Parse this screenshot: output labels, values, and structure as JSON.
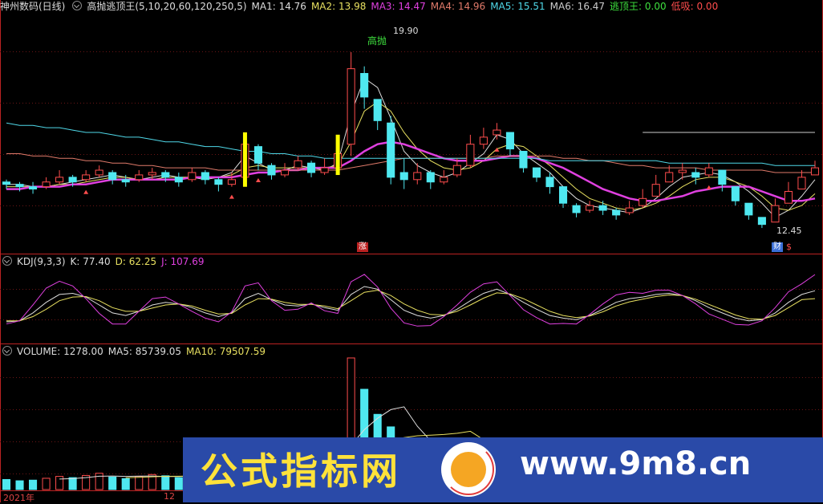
{
  "main_header": {
    "stock": "神州数码(日线)",
    "indicator": "高抛逃顶王(5,10,20,60,120,250,5)",
    "ma1_label": "MA1: 14.76",
    "ma2_label": "MA2: 13.98",
    "ma3_label": "MA3: 14.47",
    "ma4_label": "MA4: 14.96",
    "ma5_label": "MA5: 15.51",
    "ma6_label": "MA6: 16.47",
    "escape_label": "逃顶王: 0.00",
    "low_label": "低吸: 0.00"
  },
  "kdj_header": {
    "name": "KDJ(9,3,3)",
    "k_label": "K: 77.40",
    "d_label": "D: 62.25",
    "j_label": "J: 107.69"
  },
  "vol_header": {
    "name": "VOLUME: 1278.00",
    "ma5_label": "MA5: 85739.05",
    "ma10_label": "MA10: 79507.59"
  },
  "annotations": {
    "high_price": "19.90",
    "low_price": "12.45",
    "high_sell": "高抛",
    "rise_mark": "涨",
    "fin_mark": "财",
    "s_mark": "$"
  },
  "x_labels": {
    "year": "2021年",
    "month": "12"
  },
  "banner": {
    "title": "公式指标网",
    "url": "www.9m8.cn"
  },
  "colors": {
    "up": "#ff4d4d",
    "down": "#4fe8f0",
    "ma_purple": "#e040e0",
    "ma_white": "#dddddd",
    "ma_yellow": "#e8e060",
    "ma_cyan": "#4fd8e8",
    "ma_salmon": "#e07a6a",
    "signal_yellow": "#ffff00"
  },
  "chart_data": [
    {
      "type": "candlestick",
      "title": "神州数码(日线)",
      "ylim": [
        11.5,
        21.5
      ],
      "series": [
        {
          "name": "MA1",
          "values": [
            14.3,
            14.3,
            14.2,
            14.2,
            14.3,
            14.4,
            14.5,
            14.6,
            14.7,
            14.6,
            14.5,
            14.6,
            14.7,
            14.6,
            14.6,
            14.5,
            14.6,
            14.8,
            15.5,
            15.2,
            14.9,
            14.9,
            15.1,
            15.0,
            14.9,
            15.2,
            17.3,
            18.8,
            18.4,
            17.1,
            15.7,
            15.1,
            14.8,
            14.6,
            14.8,
            15.2,
            15.6,
            16.4,
            16.2,
            15.6,
            15.2,
            14.8,
            14.2,
            13.7,
            13.4,
            13.3,
            13.2,
            13.1,
            13.3,
            13.7,
            14.2,
            14.6,
            14.7,
            14.8,
            14.7,
            14.4,
            14.0,
            13.5,
            12.9,
            13.2,
            13.8,
            14.5
          ]
        },
        {
          "name": "MA2",
          "values": [
            14.2,
            14.2,
            14.2,
            14.2,
            14.3,
            14.3,
            14.4,
            14.5,
            14.6,
            14.6,
            14.5,
            14.5,
            14.6,
            14.6,
            14.6,
            14.6,
            14.6,
            14.7,
            15.0,
            15.1,
            15.0,
            15.0,
            15.0,
            15.0,
            15.0,
            15.1,
            16.1,
            17.4,
            17.8,
            17.4,
            16.5,
            15.8,
            15.3,
            15.0,
            14.9,
            15.0,
            15.3,
            15.8,
            16.0,
            15.9,
            15.5,
            15.1,
            14.6,
            14.1,
            13.7,
            13.5,
            13.3,
            13.2,
            13.3,
            13.5,
            13.8,
            14.2,
            14.5,
            14.6,
            14.6,
            14.4,
            14.2,
            13.8,
            13.3,
            13.2,
            13.4,
            13.9
          ]
        },
        {
          "name": "MA3",
          "values": [
            14.1,
            14.1,
            14.2,
            14.2,
            14.2,
            14.3,
            14.3,
            14.4,
            14.5,
            14.5,
            14.5,
            14.5,
            14.5,
            14.5,
            14.6,
            14.6,
            14.6,
            14.6,
            14.7,
            14.8,
            14.8,
            14.9,
            14.9,
            15.0,
            15.0,
            15.0,
            15.3,
            15.7,
            16.0,
            16.1,
            16.0,
            15.8,
            15.6,
            15.4,
            15.3,
            15.3,
            15.3,
            15.4,
            15.5,
            15.5,
            15.4,
            15.2,
            15.0,
            14.7,
            14.4,
            14.1,
            13.9,
            13.7,
            13.6,
            13.6,
            13.7,
            13.8,
            14.0,
            14.1,
            14.2,
            14.2,
            14.2,
            14.0,
            13.8,
            13.6,
            13.6,
            13.7
          ]
        },
        {
          "name": "MA4",
          "values": [
            15.6,
            15.6,
            15.5,
            15.5,
            15.4,
            15.4,
            15.3,
            15.3,
            15.2,
            15.2,
            15.1,
            15.1,
            15.0,
            15.0,
            15.0,
            15.0,
            14.9,
            14.9,
            14.9,
            14.9,
            14.9,
            14.9,
            14.9,
            14.9,
            14.9,
            14.9,
            15.0,
            15.1,
            15.2,
            15.3,
            15.4,
            15.4,
            15.4,
            15.4,
            15.4,
            15.4,
            15.4,
            15.5,
            15.5,
            15.5,
            15.5,
            15.5,
            15.4,
            15.4,
            15.3,
            15.3,
            15.2,
            15.1,
            15.1,
            15.0,
            15.0,
            15.0,
            15.0,
            14.9,
            14.9,
            14.9,
            14.9,
            14.9,
            14.8,
            14.8,
            14.8,
            14.8
          ]
        },
        {
          "name": "MA5",
          "values": [
            16.9,
            16.8,
            16.8,
            16.7,
            16.7,
            16.6,
            16.5,
            16.5,
            16.4,
            16.3,
            16.3,
            16.2,
            16.1,
            16.1,
            16.0,
            15.9,
            15.9,
            15.8,
            15.7,
            15.7,
            15.6,
            15.6,
            15.5,
            15.5,
            15.4,
            15.4,
            15.4,
            15.4,
            15.4,
            15.4,
            15.4,
            15.4,
            15.4,
            15.4,
            15.4,
            15.4,
            15.4,
            15.4,
            15.4,
            15.4,
            15.4,
            15.3,
            15.3,
            15.3,
            15.3,
            15.3,
            15.3,
            15.3,
            15.3,
            15.3,
            15.2,
            15.2,
            15.2,
            15.2,
            15.2,
            15.2,
            15.2,
            15.2,
            15.1,
            15.1,
            15.1,
            15.1
          ]
        },
        {
          "name": "MA6",
          "values": [
            null,
            null,
            null,
            null,
            null,
            null,
            null,
            null,
            null,
            null,
            null,
            null,
            null,
            null,
            null,
            null,
            null,
            null,
            null,
            null,
            null,
            null,
            null,
            null,
            null,
            null,
            null,
            null,
            null,
            null,
            null,
            null,
            null,
            null,
            null,
            null,
            null,
            null,
            null,
            null,
            null,
            null,
            null,
            null,
            null,
            null,
            null,
            null,
            16.5,
            16.5,
            16.5,
            16.5,
            16.5,
            16.5,
            16.5,
            16.5,
            16.5,
            16.5,
            16.5,
            16.5,
            16.5,
            16.5
          ]
        },
        {
          "name": "Close",
          "values": [
            14.3,
            14.2,
            14.1,
            14.4,
            14.6,
            14.4,
            14.7,
            14.9,
            14.5,
            14.4,
            14.7,
            14.8,
            14.6,
            14.4,
            14.8,
            14.5,
            14.3,
            14.5,
            16.0,
            15.2,
            14.7,
            14.9,
            15.3,
            14.8,
            15.0,
            15.6,
            19.2,
            18.0,
            17.0,
            14.6,
            14.5,
            14.8,
            14.4,
            14.6,
            15.1,
            16.0,
            16.3,
            16.6,
            15.8,
            15.0,
            14.6,
            14.2,
            13.5,
            13.1,
            13.4,
            13.2,
            13.0,
            13.3,
            13.7,
            14.3,
            14.8,
            14.9,
            14.6,
            15.0,
            14.3,
            13.6,
            13.0,
            12.6,
            13.4,
            14.0,
            14.6,
            15.0
          ]
        },
        {
          "name": "High",
          "values": [
            14.5,
            14.4,
            14.4,
            14.6,
            14.9,
            14.7,
            14.9,
            15.1,
            14.9,
            14.7,
            14.9,
            15.0,
            14.9,
            14.8,
            15.0,
            14.9,
            14.6,
            14.8,
            16.3,
            16.0,
            15.2,
            15.2,
            15.5,
            15.3,
            15.4,
            16.2,
            19.9,
            19.3,
            17.8,
            17.2,
            15.4,
            15.2,
            14.9,
            14.9,
            15.4,
            16.4,
            16.7,
            16.9,
            16.4,
            15.7,
            15.0,
            14.8,
            14.2,
            13.5,
            13.6,
            13.6,
            13.3,
            13.6,
            14.1,
            14.7,
            15.1,
            15.2,
            15.0,
            15.2,
            14.9,
            14.2,
            13.5,
            12.9,
            13.7,
            14.4,
            14.9,
            15.3
          ]
        },
        {
          "name": "Low",
          "values": [
            14.1,
            14.0,
            13.9,
            14.1,
            14.3,
            14.2,
            14.4,
            14.6,
            14.3,
            14.2,
            14.4,
            14.5,
            14.4,
            14.2,
            14.4,
            14.3,
            14.0,
            14.2,
            14.4,
            14.9,
            14.5,
            14.6,
            14.9,
            14.6,
            14.7,
            14.9,
            15.5,
            17.5,
            16.6,
            14.3,
            14.1,
            14.3,
            14.1,
            14.3,
            14.6,
            15.0,
            15.8,
            16.2,
            15.5,
            14.8,
            14.4,
            13.9,
            13.3,
            12.9,
            13.1,
            13.0,
            12.8,
            13.0,
            13.3,
            13.8,
            14.4,
            14.5,
            14.3,
            14.6,
            14.0,
            13.4,
            12.8,
            12.45,
            12.9,
            13.6,
            14.2,
            14.7
          ]
        },
        {
          "name": "Open",
          "values": [
            14.4,
            14.3,
            14.2,
            14.2,
            14.4,
            14.6,
            14.5,
            14.7,
            14.8,
            14.5,
            14.5,
            14.7,
            14.8,
            14.6,
            14.5,
            14.8,
            14.5,
            14.3,
            14.6,
            15.9,
            15.1,
            14.7,
            15.0,
            15.2,
            14.8,
            15.0,
            16.0,
            19.0,
            17.9,
            16.9,
            14.8,
            14.5,
            14.8,
            14.4,
            14.7,
            15.1,
            16.0,
            16.4,
            16.5,
            15.7,
            15.0,
            14.6,
            14.2,
            13.4,
            13.2,
            13.4,
            13.2,
            13.1,
            13.4,
            13.8,
            14.4,
            14.8,
            14.8,
            14.7,
            14.9,
            14.2,
            13.5,
            12.9,
            12.7,
            13.5,
            14.1,
            14.7
          ]
        }
      ]
    },
    {
      "type": "line",
      "title": "KDJ(9,3,3)",
      "ylim": [
        -20,
        120
      ],
      "series": [
        {
          "name": "K",
          "values": [
            18,
            20,
            35,
            55,
            70,
            72,
            65,
            50,
            35,
            30,
            38,
            50,
            55,
            52,
            45,
            35,
            28,
            35,
            62,
            72,
            60,
            50,
            48,
            52,
            45,
            40,
            70,
            85,
            80,
            60,
            40,
            30,
            25,
            30,
            42,
            58,
            72,
            80,
            70,
            55,
            42,
            30,
            25,
            22,
            30,
            42,
            55,
            62,
            65,
            70,
            72,
            68,
            58,
            45,
            35,
            25,
            20,
            22,
            35,
            55,
            70,
            77
          ]
        },
        {
          "name": "D",
          "values": [
            20,
            20,
            28,
            42,
            58,
            65,
            66,
            58,
            45,
            38,
            38,
            44,
            50,
            52,
            48,
            40,
            33,
            34,
            50,
            62,
            61,
            55,
            51,
            51,
            48,
            43,
            58,
            74,
            78,
            68,
            52,
            40,
            32,
            31,
            38,
            50,
            63,
            73,
            71,
            62,
            50,
            38,
            30,
            26,
            29,
            37,
            48,
            56,
            61,
            66,
            69,
            68,
            61,
            51,
            41,
            31,
            24,
            23,
            30,
            45,
            60,
            62
          ]
        },
        {
          "name": "J",
          "values": [
            14,
            20,
            50,
            82,
            95,
            86,
            62,
            34,
            14,
            14,
            38,
            62,
            65,
            52,
            38,
            25,
            18,
            37,
            86,
            92,
            58,
            40,
            42,
            54,
            39,
            34,
            94,
            108,
            84,
            44,
            16,
            10,
            11,
            28,
            50,
            74,
            90,
            94,
            68,
            41,
            26,
            14,
            15,
            14,
            32,
            52,
            69,
            74,
            72,
            78,
            78,
            68,
            52,
            33,
            23,
            13,
            12,
            20,
            45,
            75,
            90,
            107.69
          ]
        }
      ]
    },
    {
      "type": "bar",
      "title": "VOLUME",
      "values": [
        32000,
        28000,
        30000,
        36000,
        42000,
        38000,
        45000,
        52000,
        40000,
        35000,
        42000,
        48000,
        44000,
        38000,
        46000,
        40000,
        34000,
        42000,
        120000,
        90000,
        60000,
        55000,
        70000,
        58000,
        62000,
        95000,
        420000,
        320000,
        240000,
        200000,
        140000,
        110000,
        90000,
        80000,
        100000,
        160000,
        150000,
        130000,
        110000,
        90000,
        80000,
        70000,
        65000,
        60000,
        62000,
        58000,
        56000,
        60000,
        70000,
        85000,
        95000,
        90000,
        82000,
        86000,
        80000,
        74000,
        68000,
        64000,
        72000,
        80000,
        86000,
        85739
      ]
    }
  ]
}
